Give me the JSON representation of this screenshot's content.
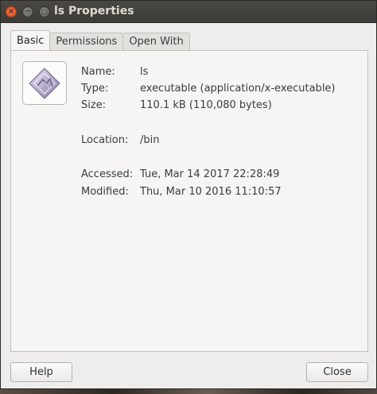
{
  "window": {
    "title": "ls Properties",
    "controls": {
      "close": "×",
      "minimize": "−",
      "maximize": "□"
    }
  },
  "tabs": [
    {
      "label": "Basic",
      "active": true
    },
    {
      "label": "Permissions",
      "active": false
    },
    {
      "label": "Open With",
      "active": false
    }
  ],
  "file": {
    "icon": "executable-file-icon",
    "name_label": "Name:",
    "name": "ls",
    "type_label": "Type:",
    "type": "executable (application/x-executable)",
    "size_label": "Size:",
    "size": "110.1 kB (110,080 bytes)",
    "location_label": "Location:",
    "location": "/bin",
    "accessed_label": "Accessed:",
    "accessed": "Tue, Mar 14 2017 22:28:49",
    "modified_label": "Modified:",
    "modified": "Thu, Mar 10 2016 11:10:57"
  },
  "buttons": {
    "help": "Help",
    "close": "Close"
  },
  "colors": {
    "close_button": "#df4a16",
    "titlebar": "#3c3b37",
    "window_bg": "#efedec"
  }
}
